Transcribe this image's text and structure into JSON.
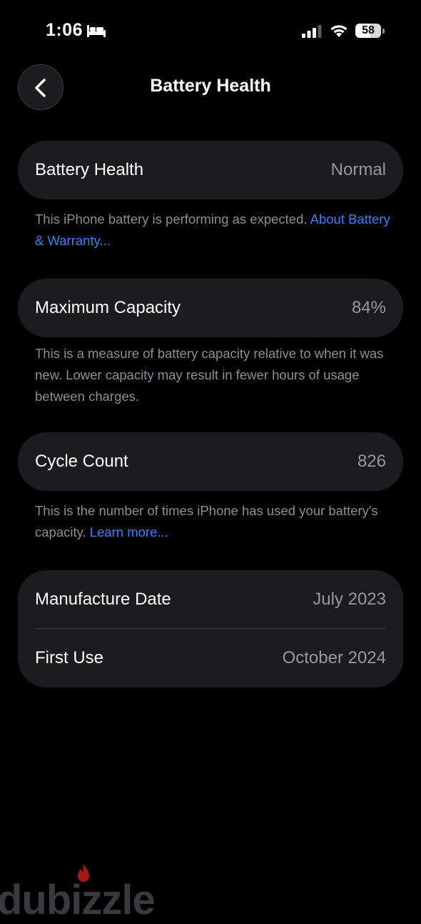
{
  "status_bar": {
    "time": "1:06",
    "battery_percent": "58",
    "icons": [
      "bed-icon",
      "cellular-signal-icon",
      "wifi-icon",
      "battery-icon"
    ]
  },
  "nav": {
    "back_icon": "chevron-left-icon",
    "title": "Battery Health"
  },
  "sections": {
    "health": {
      "label": "Battery Health",
      "value": "Normal",
      "footnote_text": "This iPhone battery is performing as expected. ",
      "footnote_link": "About Battery & Warranty..."
    },
    "capacity": {
      "label": "Maximum Capacity",
      "value": "84%",
      "footnote_text": "This is a measure of battery capacity relative to when it was new. Lower capacity may result in fewer hours of usage between charges."
    },
    "cycles": {
      "label": "Cycle Count",
      "value": "826",
      "footnote_text": "This is the number of times iPhone has used your battery's capacity. ",
      "footnote_link": "Learn more..."
    },
    "dates": {
      "manufacture_label": "Manufacture Date",
      "manufacture_value": "July 2023",
      "first_use_label": "First Use",
      "first_use_value": "October 2024"
    }
  },
  "watermark": {
    "text": "dubizzle"
  },
  "colors": {
    "background": "#000000",
    "card": "#1c1c1e",
    "secondary_text": "#98989e",
    "link": "#3a82f7",
    "flame": "#e0211e"
  }
}
